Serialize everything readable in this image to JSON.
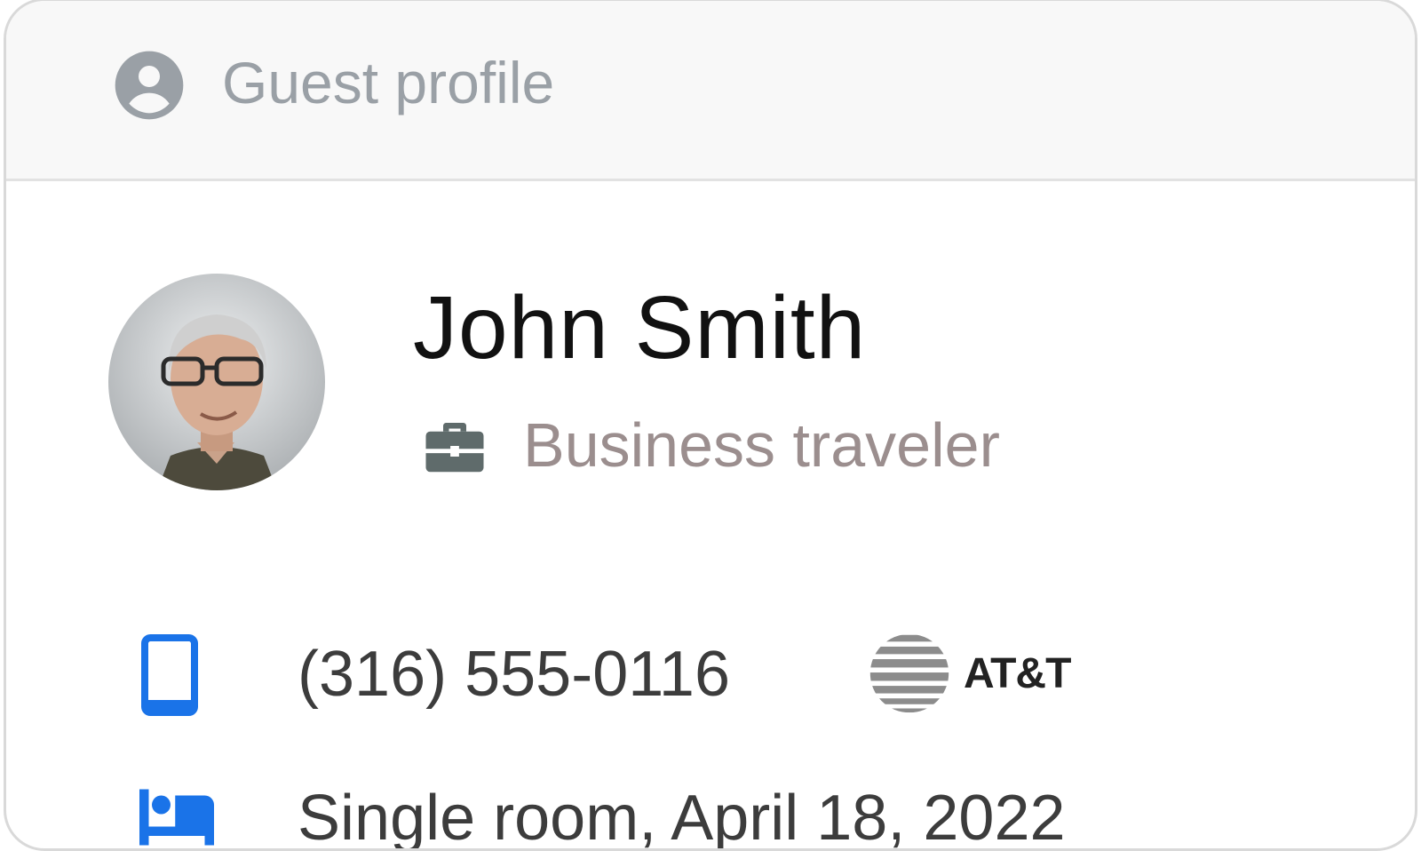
{
  "header": {
    "title": "Guest profile",
    "icon": "account-circle-icon"
  },
  "guest": {
    "name": "John Smith",
    "tag_icon": "briefcase-icon",
    "tag": "Business traveler"
  },
  "contact": {
    "phone_icon": "smartphone-icon",
    "phone": "(316) 555-0116",
    "carrier_logo": "att-globe-logo",
    "carrier": "AT&T"
  },
  "booking": {
    "room_icon": "bed-icon",
    "summary": "Single room, April 18, 2022"
  },
  "colors": {
    "header_bg": "#f8f8f8",
    "muted_text": "#9aa0a6",
    "tag_text": "#9b8e8e",
    "accent_blue": "#1a73e8",
    "icon_slate": "#5f6b6b"
  }
}
